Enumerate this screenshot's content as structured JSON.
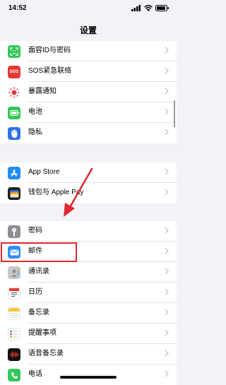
{
  "status": {
    "time": "14:52"
  },
  "nav": {
    "title": "设置"
  },
  "groups": [
    {
      "items": [
        {
          "label": "面容ID与密码",
          "icon": "face-id-icon",
          "color": "#34c759"
        },
        {
          "label": "SOS紧急联络",
          "icon": "sos-icon",
          "color": "#e53935"
        },
        {
          "label": "暴露通知",
          "icon": "exposure-notification-icon",
          "color": "#ffffff"
        },
        {
          "label": "电池",
          "icon": "battery-icon",
          "color": "#34c759"
        },
        {
          "label": "隐私",
          "icon": "hand-icon",
          "color": "#2f6fe4"
        }
      ]
    },
    {
      "items": [
        {
          "label": "App Store",
          "icon": "app-store-icon",
          "color": "#1e8ef7"
        },
        {
          "label": "钱包与 Apple Pay",
          "icon": "wallet-icon",
          "color": "#222222"
        }
      ]
    },
    {
      "items": [
        {
          "label": "密码",
          "icon": "key-icon",
          "color": "#8e8e93"
        },
        {
          "label": "邮件",
          "icon": "mail-icon",
          "color": "#2f8ef5"
        },
        {
          "label": "通讯录",
          "icon": "contacts-icon",
          "color": "#c8c8cc"
        },
        {
          "label": "日历",
          "icon": "calendar-icon",
          "color": "#ffffff"
        },
        {
          "label": "备忘录",
          "icon": "notes-icon",
          "color": "#f5c833"
        },
        {
          "label": "提醒事项",
          "icon": "reminders-icon",
          "color": "#ffffff"
        },
        {
          "label": "语音备忘录",
          "icon": "voice-memos-icon",
          "color": "#111111"
        },
        {
          "label": "电话",
          "icon": "phone-icon",
          "color": "#34c759"
        }
      ]
    }
  ],
  "highlight_color": "#e0282e"
}
